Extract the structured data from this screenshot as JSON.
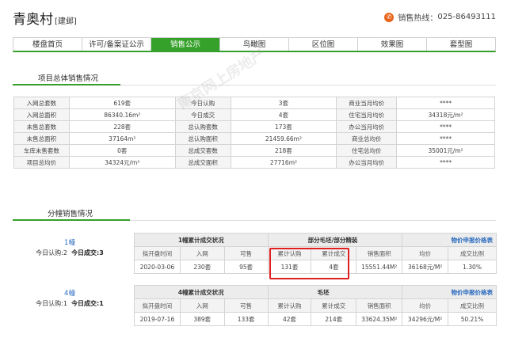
{
  "header": {
    "title": "青奥村",
    "subtitle": "[建邺]",
    "hotline_label": "销售热线：",
    "hotline_number": "025-86493111"
  },
  "nav": [
    "楼盘首页",
    "许可/备案证公示",
    "销售公示",
    "鸟瞰图",
    "区位图",
    "效果图",
    "套型图"
  ],
  "overall": {
    "title": "项目总体销售情况",
    "rows": [
      [
        "入网总套数",
        "619套",
        "今日认购",
        "3套",
        "商业当月均价",
        "****"
      ],
      [
        "入网总面积",
        "86340.16m²",
        "今日成交",
        "4套",
        "住宅当月均价",
        "34318元/m²"
      ],
      [
        "未售总套数",
        "228套",
        "总认购套数",
        "173套",
        "办公当月均价",
        "****"
      ],
      [
        "未售总面积",
        "37164m²",
        "总认购面积",
        "21459.66m²",
        "商业总均价",
        "****"
      ],
      [
        "车库未售套数",
        "0套",
        "总成交套数",
        "218套",
        "住宅总均价",
        "35001元/m²"
      ],
      [
        "项目总均价",
        "34324元/m²",
        "总成交面积",
        "27716m²",
        "办公当月均价",
        "****"
      ]
    ]
  },
  "buildings": {
    "title": "分幢销售情况",
    "price_link": "物价申报价格表",
    "columns": [
      "拟开盘时间",
      "入网",
      "可售",
      "累计认购",
      "累计成交",
      "销售面积",
      "均价",
      "成交比例"
    ],
    "items": [
      {
        "name": "1幢",
        "today_sub_label": "今日认购:2",
        "today_deal_label": "今日成交:3",
        "status_title": "1幢累计成交状况",
        "decoration": "部分毛坯/部分精装",
        "row": [
          "2020-03-06",
          "230套",
          "95套",
          "131套",
          "4套",
          "15551.44M²",
          "36168元/M²",
          "1.30%"
        ]
      },
      {
        "name": "4幢",
        "today_sub_label": "今日认购:1",
        "today_deal_label": "今日成交:1",
        "status_title": "4幢累计成交状况",
        "decoration": "毛坯",
        "row": [
          "2019-07-16",
          "389套",
          "133套",
          "42套",
          "214套",
          "33624.35M²",
          "34296元/M²",
          "50.21%"
        ]
      }
    ]
  },
  "watermark": "南京网上房地产",
  "colors": {
    "accent": "#35a12a",
    "link": "#2a6bbf",
    "highlight": "#e02020",
    "phone": "#e8641b"
  }
}
